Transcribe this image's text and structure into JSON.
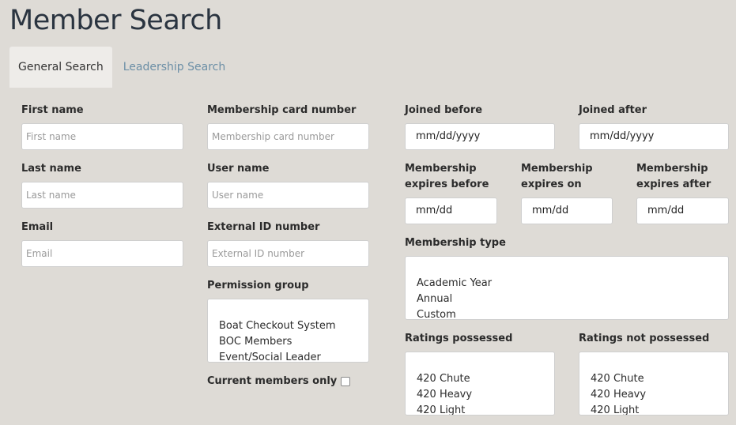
{
  "page": {
    "title": "Member Search"
  },
  "tabs": [
    {
      "label": "General Search"
    },
    {
      "label": "Leadership Search"
    }
  ],
  "form": {
    "first_name": {
      "label": "First name",
      "placeholder": "First name"
    },
    "last_name": {
      "label": "Last name",
      "placeholder": "Last name"
    },
    "email": {
      "label": "Email",
      "placeholder": "Email"
    },
    "card_number": {
      "label": "Membership card number",
      "placeholder": "Membership card number"
    },
    "user_name": {
      "label": "User name",
      "placeholder": "User name"
    },
    "external_id": {
      "label": "External ID number",
      "placeholder": "External ID number"
    },
    "permission_group": {
      "label": "Permission group",
      "options": [
        "Boat Checkout System",
        "BOC Members",
        "Event/Social Leader"
      ]
    },
    "current_members": {
      "label": "Current members only"
    },
    "joined_before": {
      "label": "Joined before",
      "value": "mm/dd/yyyy"
    },
    "joined_after": {
      "label": "Joined after",
      "value": "mm/dd/yyyy"
    },
    "expires_before": {
      "label_line1": "Membership",
      "label_line2": "expires before",
      "value": "mm/dd"
    },
    "expires_on": {
      "label_line1": "Membership",
      "label_line2": "expires on",
      "value": "mm/dd"
    },
    "expires_after": {
      "label_line1": "Membership",
      "label_line2": "expires after",
      "value": "mm/dd"
    },
    "membership_type": {
      "label": "Membership type",
      "options": [
        "Academic Year",
        "Annual",
        "Custom"
      ]
    },
    "ratings_possessed": {
      "label": "Ratings possessed",
      "options": [
        "420 Chute",
        "420 Heavy",
        "420 Light"
      ]
    },
    "ratings_not_possessed": {
      "label": "Ratings not possessed",
      "options": [
        "420 Chute",
        "420 Heavy",
        "420 Light"
      ]
    }
  }
}
